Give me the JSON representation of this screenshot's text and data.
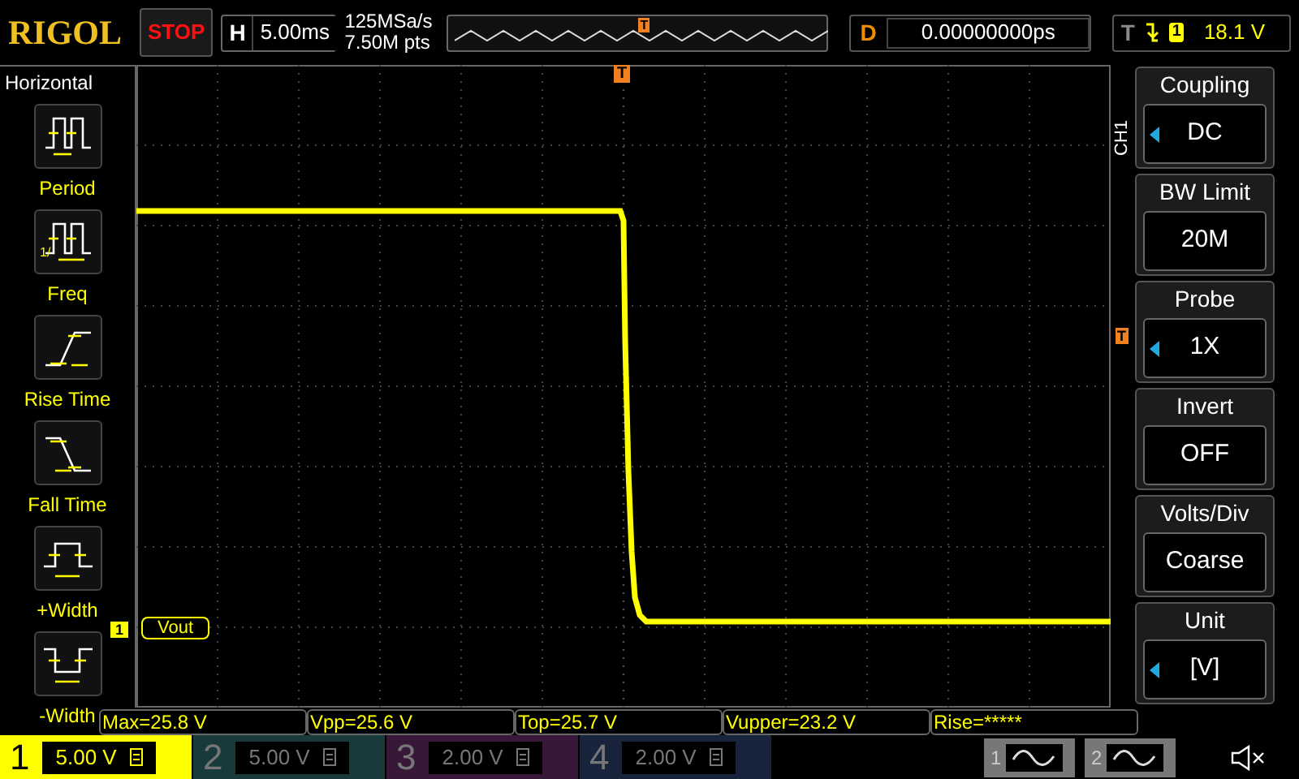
{
  "header": {
    "logo": "RIGOL",
    "run_state": "STOP",
    "timebase": {
      "label": "H",
      "value": "5.00ms"
    },
    "sample_rate": "125MSa/s",
    "memory_depth": "7.50M pts",
    "overview_trigger": "T",
    "delay": {
      "label": "D",
      "value": "0.00000000ps"
    },
    "trigger": {
      "label": "T",
      "source": "1",
      "level": "18.1 V"
    }
  },
  "left_menu": {
    "title": "Horizontal",
    "items": [
      {
        "kind": "period",
        "label": "Period"
      },
      {
        "kind": "freq",
        "label": "Freq",
        "icon_text": "1/"
      },
      {
        "kind": "rise",
        "label": "Rise Time"
      },
      {
        "kind": "fall",
        "label": "Fall Time"
      },
      {
        "kind": "pwidth",
        "label": "+Width"
      },
      {
        "kind": "nwidth",
        "label": "-Width"
      }
    ]
  },
  "graph": {
    "trigger_marker": "T",
    "trigger_level_marker": "T",
    "channel_marker": "1",
    "channel_label": "Vout"
  },
  "right_menu": {
    "channel": "CH1",
    "items": [
      {
        "title": "Coupling",
        "value": "DC",
        "adjustable": true
      },
      {
        "title": "BW Limit",
        "value": "20M",
        "adjustable": false
      },
      {
        "title": "Probe",
        "value": "1X",
        "adjustable": true
      },
      {
        "title": "Invert",
        "value": "OFF",
        "adjustable": false
      },
      {
        "title": "Volts/Div",
        "value": "Coarse",
        "adjustable": false
      },
      {
        "title": "Unit",
        "value": "[V]",
        "adjustable": true
      }
    ]
  },
  "measurements": [
    "Max=25.8 V",
    "Vpp=25.6 V",
    "Top=25.7 V",
    "Vupper=23.2 V",
    "Rise=*****"
  ],
  "channels": [
    {
      "number": "1",
      "scale": "5.00 V",
      "active": true,
      "color": "#ffff00"
    },
    {
      "number": "2",
      "scale": "5.00 V",
      "active": false,
      "color": "#183a3a"
    },
    {
      "number": "3",
      "scale": "2.00 V",
      "active": false,
      "color": "#381838"
    },
    {
      "number": "4",
      "scale": "2.00 V",
      "active": false,
      "color": "#18243c"
    }
  ],
  "generators": [
    "1",
    "2"
  ]
}
